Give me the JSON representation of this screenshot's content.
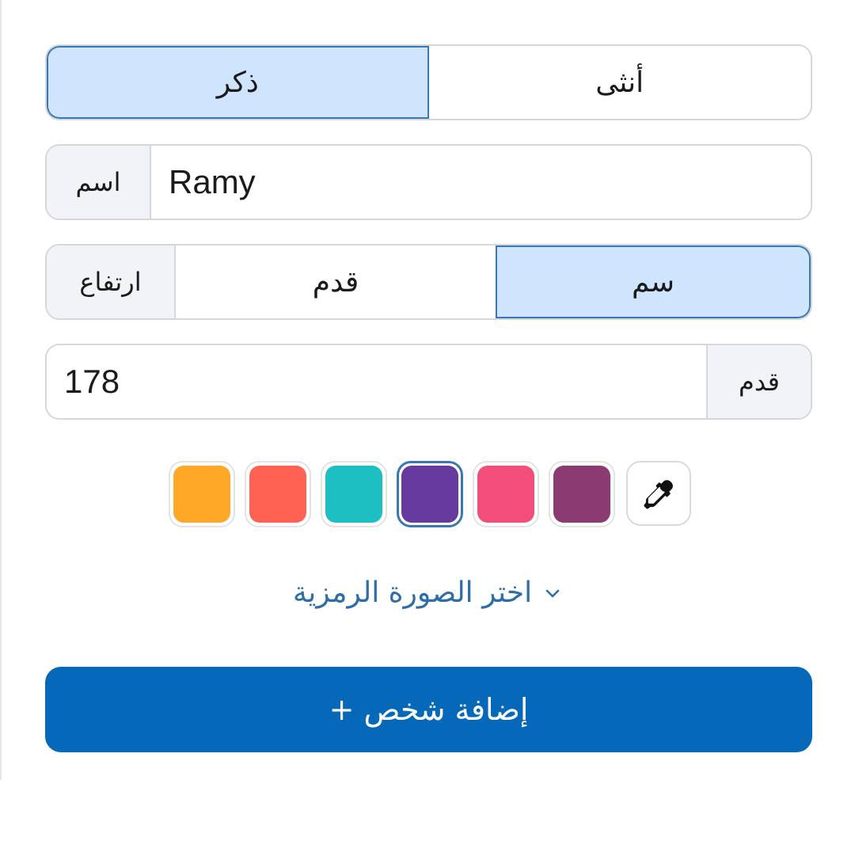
{
  "gender": {
    "male_label": "ذكر",
    "female_label": "أنثى",
    "selected": "male"
  },
  "name": {
    "label": "اسم",
    "value": "Ramy"
  },
  "height_units": {
    "label": "ارتفاع",
    "feet_label": "قدم",
    "cm_label": "سم",
    "selected": "cm"
  },
  "height": {
    "value": "178",
    "unit_label": "قدم"
  },
  "colors": {
    "options": [
      "#ffa726",
      "#ff6252",
      "#1dbfc3",
      "#673b9e",
      "#f34d7b",
      "#8b3b72"
    ],
    "selected": "#673b9e",
    "picker_icon": "eyedropper-icon"
  },
  "avatar": {
    "toggle_label": "اختر الصورة الرمزية",
    "icon": "chevron-down-icon"
  },
  "add_button": {
    "label": "إضافة شخص +"
  }
}
